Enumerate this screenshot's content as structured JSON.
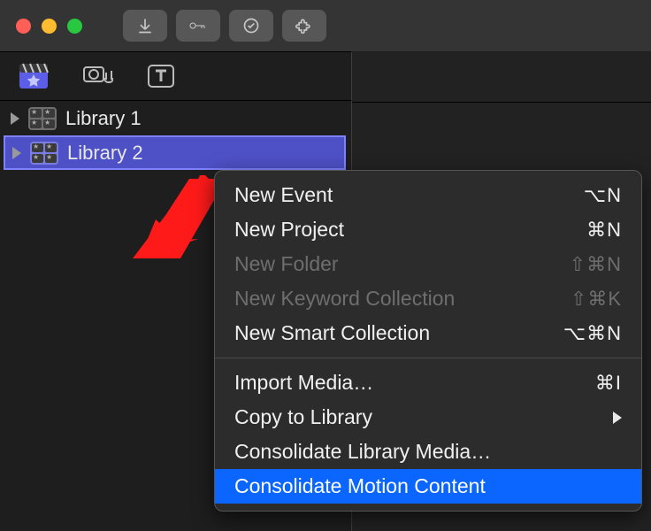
{
  "sidebar": {
    "items": [
      {
        "label": "Library 1"
      },
      {
        "label": "Library 2"
      }
    ]
  },
  "contextMenu": {
    "section1": [
      {
        "label": "New Event",
        "shortcut": "⌥N",
        "disabled": false
      },
      {
        "label": "New Project",
        "shortcut": "⌘N",
        "disabled": false
      },
      {
        "label": "New Folder",
        "shortcut": "⇧⌘N",
        "disabled": true
      },
      {
        "label": "New Keyword Collection",
        "shortcut": "⇧⌘K",
        "disabled": true
      },
      {
        "label": "New Smart Collection",
        "shortcut": "⌥⌘N",
        "disabled": false
      }
    ],
    "section2": [
      {
        "label": "Import Media…",
        "shortcut": "⌘I",
        "submenu": false
      },
      {
        "label": "Copy to Library",
        "shortcut": "",
        "submenu": true
      },
      {
        "label": "Consolidate Library Media…",
        "shortcut": "",
        "submenu": false
      },
      {
        "label": "Consolidate Motion Content",
        "shortcut": "",
        "submenu": false,
        "highlighted": true
      }
    ]
  }
}
